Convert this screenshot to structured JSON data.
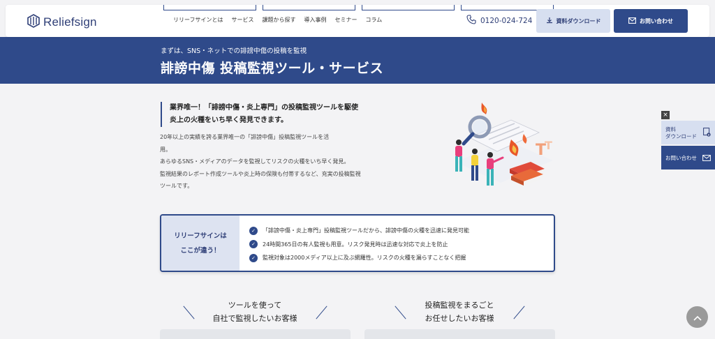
{
  "header": {
    "logo_text": "Reliefsign",
    "nav": [
      "リリーフサインとは",
      "サービス",
      "課題から探す",
      "導入事例",
      "セミナー",
      "コラム"
    ],
    "phone": "0120-024-724",
    "download_label": "資料ダウンロード",
    "contact_label": "お問い合わせ"
  },
  "hero": {
    "subtitle": "まずは、SNS・ネットでの誹謗中傷の投稿を監視",
    "title": "誹謗中傷 投稿監視ツール・サービス"
  },
  "intro": {
    "lead_lines": [
      "業界唯一！「誹謗中傷・炎上専門」の投稿監視ツールを駆使",
      "炎上の火種をいち早く発見できます。"
    ],
    "body_lines": [
      "20年以上の実績を誇る業界唯一の「誹謗中傷」投稿監視ツールを活",
      "用。",
      "あらゆるSNS・メディアのデータを監視してリスクの火種をいち早く発見。",
      "監視結果のレポート作成ツールや炎上時の保険も付帯するなど、充実の投稿監視",
      "ツールです。"
    ]
  },
  "difference": {
    "heading_lines": [
      "リリーフサインは",
      "ここが違う！"
    ],
    "points": [
      "「誹謗中傷・炎上専門」投稿監視ツールだから、誹謗中傷の火種を迅速に発見可能",
      "24時間365日の有人監視も用意。リスク発見時は迅速な対応で炎上を防止",
      "監視対象は2000メディア以上に及ぶ網羅性。リスクの火種を漏らすことなく把握"
    ]
  },
  "customers": [
    {
      "lines": [
        "ツールを使って",
        "自社で監視したいお客様"
      ]
    },
    {
      "lines": [
        "投稿監視をまるごと",
        "お任せしたいお客様"
      ]
    }
  ],
  "side": {
    "close": "×",
    "download_lines": [
      "資料",
      "ダウンロード"
    ],
    "contact_label": "お問い合わせ"
  },
  "colors": {
    "brand": "#2f4a8a",
    "brand_light": "#d7dff0",
    "background": "#f3f3f5"
  },
  "icons": [
    "logo-mark-icon",
    "phone-icon",
    "download-icon",
    "mail-icon",
    "check-icon",
    "close-icon",
    "chevron-up-icon"
  ]
}
